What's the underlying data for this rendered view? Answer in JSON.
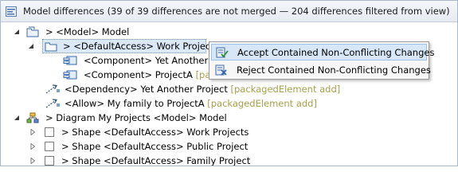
{
  "header": {
    "title": "Model differences",
    "status": "(39 of 39 differences are not merged — 204 differences filtered from view)"
  },
  "tree": [
    {
      "prefix": "> ",
      "label": "<Model> Model",
      "hint": ""
    },
    {
      "prefix": "> ",
      "label": "<DefaultAccess> Work Projects",
      "hint": ""
    },
    {
      "prefix": "",
      "label": "<Component> Yet Another Pr",
      "hint": ""
    },
    {
      "prefix": "",
      "label": "<Component> ProjectA",
      "hint": "[pac"
    },
    {
      "prefix": "",
      "label": "<Dependency> Yet Another Project",
      "hint": "[packagedElement add]"
    },
    {
      "prefix": "",
      "label": "<Allow> My family to ProjectA",
      "hint": "[packagedElement add]"
    },
    {
      "prefix": "> ",
      "label": "Diagram My Projects <Model> Model",
      "hint": ""
    },
    {
      "prefix": "> ",
      "label": "Shape <DefaultAccess> Work Projects",
      "hint": ""
    },
    {
      "prefix": "> ",
      "label": "Shape <DefaultAccess> Public Project",
      "hint": ""
    },
    {
      "prefix": "> ",
      "label": "Shape <DefaultAccess> Family Project",
      "hint": ""
    }
  ],
  "context_menu": {
    "items": [
      {
        "label": "Accept Contained Non-Conflicting Changes",
        "icon": "accept-changes-icon"
      },
      {
        "label": "Reject Contained Non-Conflicting Changes",
        "icon": "reject-changes-icon"
      }
    ]
  },
  "colors": {
    "selection": "#dbe8f7",
    "menu_hover": "#d7e7f7",
    "hint_text": "#a8a04b",
    "icon_blue": "#2f66b3"
  }
}
